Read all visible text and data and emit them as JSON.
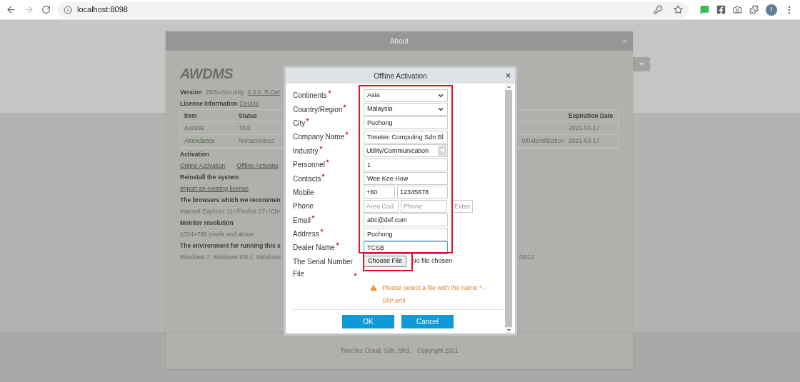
{
  "browser": {
    "url": "localhost:8098",
    "avatar": "I"
  },
  "about": {
    "title": "About",
    "close": "×",
    "logo": "AWDMS",
    "version": {
      "label": "Version",
      "product": "ZKBioSecurity",
      "number": "2.0.0_R.Det"
    },
    "license": {
      "label": "License Information",
      "link": "Details"
    },
    "table": {
      "columns": [
        "Item",
        "Status",
        "Expiration Date"
      ],
      "rows": [
        {
          "item": "Access",
          "status": "Trial",
          "expiration": "2021-03-17"
        },
        {
          "item": "Attendance",
          "status": "Nonactivated",
          "column_3": "0/0Identification",
          "expiration": "2021-03-17"
        }
      ]
    },
    "sections": [
      {
        "heading": "Activation",
        "links": [
          "Online Activation",
          "Offline Activatio"
        ]
      },
      {
        "heading": "Reinstall the system",
        "links": [
          "Import an existing license"
        ]
      },
      {
        "heading": "The browsers which we recommen",
        "text": "Internet Explorer 11+/Firefox 27+/Chr"
      },
      {
        "heading": "Monitor resolution",
        "text": "1024×768 pixels and above"
      },
      {
        "heading": "The environment for running this s",
        "text": "Windows 7, Windows 8/8.1, Windows",
        "text_right": "/2012"
      }
    ],
    "footer": [
      "TimeTec Cloud. Sdn. Bhd.",
      "Copyright 2021"
    ]
  },
  "dialog": {
    "title": "Offline Activation",
    "close": "×",
    "fields": [
      {
        "kind": "select",
        "label": "Continents",
        "required": true,
        "value": "Asia"
      },
      {
        "kind": "select",
        "label": "Country/Region",
        "required": true,
        "value": "Malaysia"
      },
      {
        "kind": "text",
        "label": "City",
        "required": true,
        "value": "Puchong",
        "focused": false
      },
      {
        "kind": "text",
        "label": "Company Name",
        "required": true,
        "value": "Timetec Computing Sdn Bl",
        "focused": false
      },
      {
        "kind": "combo",
        "label": "Industry",
        "required": true,
        "value": "Utility/Communication"
      },
      {
        "kind": "text",
        "label": "Personnel",
        "required": true,
        "value": "1",
        "focused": false
      },
      {
        "kind": "text",
        "label": "Contacts",
        "required": true,
        "value": "Wee Kee How",
        "focused": false
      },
      {
        "kind": "parts",
        "label": "Mobile",
        "required": false,
        "parts": [
          {
            "value": "+60"
          },
          {
            "value": "12345678"
          }
        ]
      },
      {
        "kind": "parts",
        "label": "Phone",
        "required": false,
        "parts": [
          {
            "placeholder": "Area Cod"
          },
          {
            "placeholder": "Phone"
          },
          {
            "placeholder": "Exten"
          }
        ]
      },
      {
        "kind": "text",
        "label": "Email",
        "required": true,
        "value": "abc@def.com",
        "focused": false
      },
      {
        "kind": "text",
        "label": "Address",
        "required": true,
        "value": "Puchong",
        "focused": false
      },
      {
        "kind": "text",
        "label": "Dealer Name",
        "required": true,
        "value": "TCSB",
        "focused": true
      },
      {
        "kind": "file",
        "label": "The Serial Number File",
        "required": true,
        "button": "Choose File",
        "status": "No file chosen"
      }
    ],
    "warning": "Please select a file with the name * - SN*.xml",
    "buttons": [
      "OK",
      "Cancel"
    ]
  }
}
